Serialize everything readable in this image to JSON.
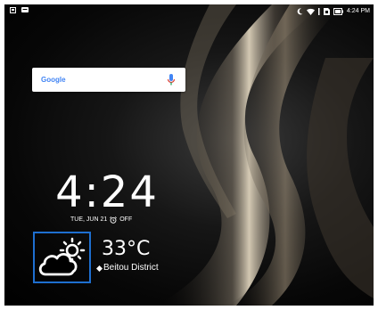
{
  "status_bar": {
    "time": "4:24 PM",
    "left_icons": [
      "notification-icon",
      "message-icon"
    ],
    "right_icons": [
      "do-not-disturb-moon-icon",
      "wifi-icon",
      "sim-icon",
      "battery-icon"
    ]
  },
  "search": {
    "logo": "Google",
    "mic_icon": "mic-icon"
  },
  "clock": {
    "time": "4:24",
    "date": "TUE, JUN 21",
    "alarm": "OFF"
  },
  "weather": {
    "icon": "partly-cloudy-icon",
    "temperature": "33°C",
    "location": "Beitou District"
  },
  "colors": {
    "highlight": "#1e6fd0",
    "background": "#000000",
    "text": "#ffffff"
  }
}
